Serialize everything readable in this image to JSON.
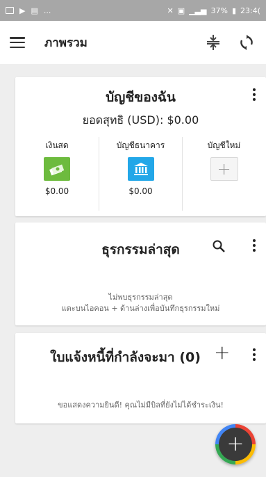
{
  "status_bar": {
    "left_text": "...",
    "right_text": "37%",
    "time": "23:4("
  },
  "app_bar": {
    "title": "ภาพรวม"
  },
  "accounts_card": {
    "title": "บัญชีของฉัน",
    "net_label": "ยอดสุทธิ (USD):",
    "net_value": "$0.00",
    "items": [
      {
        "label": "เงินสด",
        "value": "$0.00",
        "icon": "cash-icon",
        "color": "#6dbb3e"
      },
      {
        "label": "บัญชีธนาคาร",
        "value": "$0.00",
        "icon": "bank-icon",
        "color": "#23a7e8"
      },
      {
        "label": "บัญชีใหม่",
        "value": "",
        "icon": "plus-icon",
        "color": "#f5f5f5"
      }
    ]
  },
  "transactions_card": {
    "title": "ธุรกรรมล่าสุด",
    "empty_line1": "ไม่พบธุรกรรมล่าสุด",
    "empty_line2": "แตะบนไอคอน + ด้านล่างเพื่อบันทึกธุรกรรมใหม่"
  },
  "bills_card": {
    "title": "ใบแจ้งหนี้ที่กำลังจะมา (0)",
    "plus": "+",
    "empty": "ขอแสดงความยินดี! คุณไม่มีบิลที่ยังไม่ได้ชำระเงิน!"
  },
  "fab": {
    "label": "+"
  }
}
